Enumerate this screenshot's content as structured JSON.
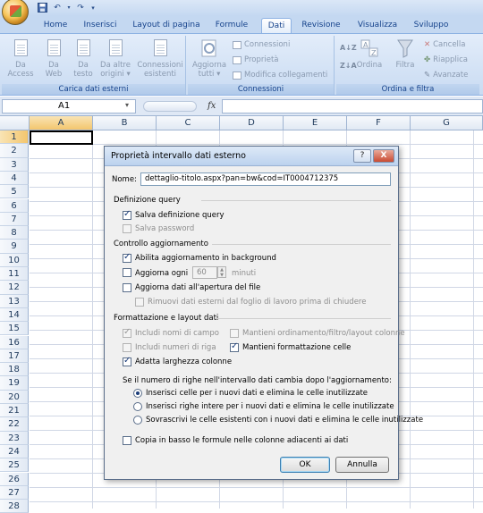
{
  "quick_access": [
    "save",
    "undo",
    "redo"
  ],
  "tabs": [
    "Home",
    "Inserisci",
    "Layout di pagina",
    "Formule",
    "Dati",
    "Revisione",
    "Visualizza",
    "Sviluppo"
  ],
  "active_tab": "Dati",
  "ribbon": {
    "groups": [
      {
        "label": "Carica dati esterni",
        "buttons": [
          "Da\nAccess",
          "Da\nWeb",
          "Da\ntesto",
          "Da altre\norigini ▾",
          "Connessioni\nesistenti"
        ]
      },
      {
        "label": "Connessioni",
        "buttons": [
          "Aggiorna\ntutti ▾"
        ],
        "small": [
          "Connessioni",
          "Proprietà",
          "Modifica collegamenti"
        ]
      },
      {
        "label": "Ordina e filtra",
        "buttons": [
          "Ordina",
          "Filtra"
        ],
        "small": [
          "Cancella",
          "Riapplica",
          "Avanzate"
        ]
      }
    ]
  },
  "formula_bar": {
    "name_box": "A1",
    "fx": "fx",
    "formula": ""
  },
  "columns": [
    "A",
    "B",
    "C",
    "D",
    "E",
    "F",
    "G"
  ],
  "rows": [
    "1",
    "2",
    "3",
    "4",
    "5",
    "6",
    "7",
    "8",
    "9",
    "10",
    "11",
    "12",
    "13",
    "14",
    "15",
    "16",
    "17",
    "18",
    "19",
    "20",
    "21",
    "22",
    "23",
    "24",
    "25",
    "26",
    "27",
    "28"
  ],
  "dialog": {
    "title": "Proprietà intervallo dati esterno",
    "help": "?",
    "close": "X",
    "name_label": "Nome:",
    "name_value": "dettaglio-titolo.aspx?pan=bw&cod=IT0004712375",
    "section_query": "Definizione query",
    "save_query": "Salva definizione query",
    "save_password": "Salva password",
    "section_refresh": "Controllo aggiornamento",
    "bg_refresh": "Abilita aggiornamento in background",
    "refresh_every": "Aggiorna ogni",
    "refresh_minutes": "60",
    "minutes_label": "minuti",
    "refresh_on_open": "Aggiorna dati all'apertura del file",
    "remove_data": "Rimuovi dati esterni dal foglio di lavoro prima di chiudere",
    "section_format": "Formattazione e layout dati",
    "include_field_names": "Includi nomi di campo",
    "keep_sort": "Mantieni ordinamento/filtro/layout colonne",
    "include_row_numbers": "Includi numeri di riga",
    "keep_format": "Mantieni formattazione celle",
    "adjust_width": "Adatta larghezza colonne",
    "rows_question": "Se il numero di righe nell'intervallo dati cambia dopo l'aggiornamento:",
    "radio_insert_cells": "Inserisci celle per i nuovi dati e elimina le celle inutilizzate",
    "radio_insert_rows": "Inserisci righe intere per i nuovi dati e elimina le celle inutilizzate",
    "radio_overwrite": "Sovrascrivi le celle esistenti con i nuovi dati e elimina le celle inutilizzate",
    "copy_formulas": "Copia in basso le formule nelle colonne adiacenti ai dati",
    "ok": "OK",
    "cancel": "Annulla"
  }
}
